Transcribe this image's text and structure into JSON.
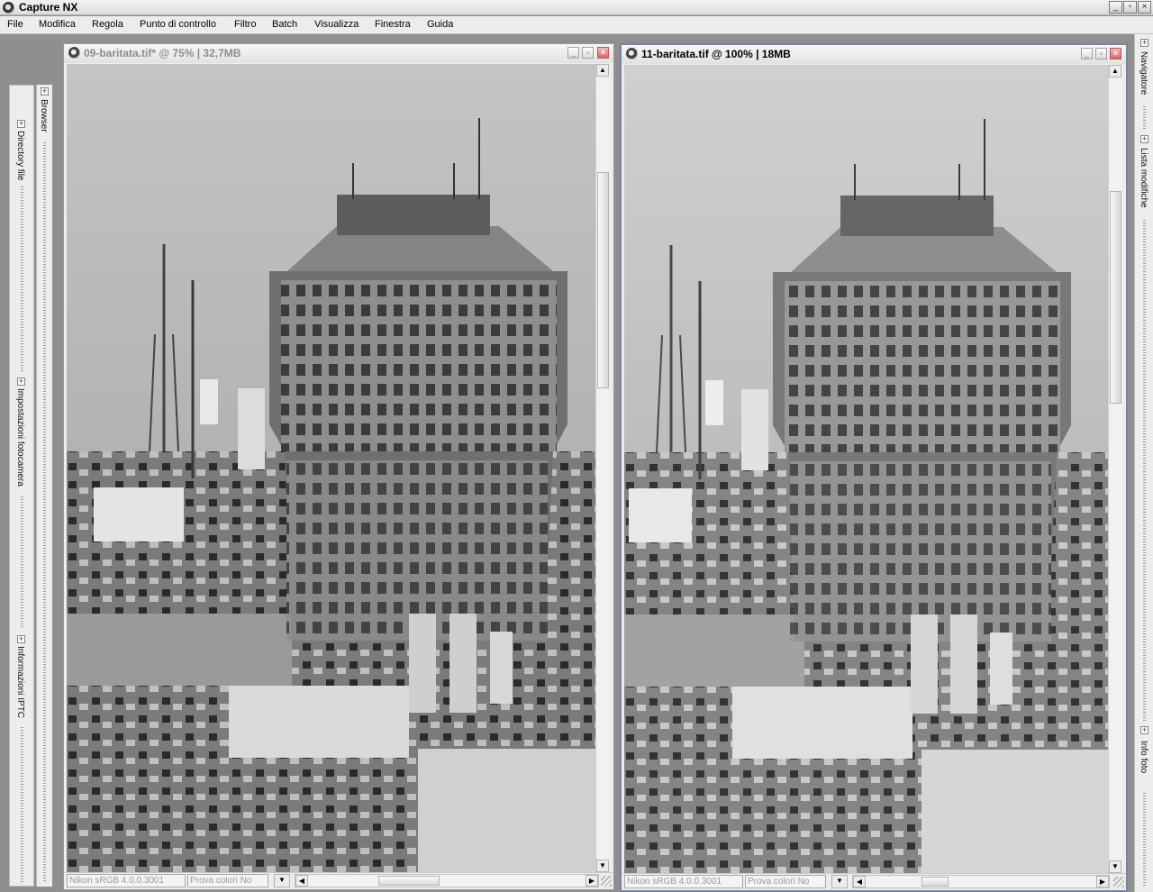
{
  "app": {
    "title": "Capture NX",
    "title_controls": [
      "_",
      "▫",
      "×"
    ]
  },
  "menu": [
    "File",
    "Modifica",
    "Regola",
    "Punto di controllo",
    "Filtro",
    "Batch",
    "Visualizza",
    "Finestra",
    "Guida"
  ],
  "left_panel": {
    "browser_tab": "Browser",
    "tabs": [
      "Directory file",
      "Impostazioni fotocamera",
      "Informazioni IPTC"
    ]
  },
  "right_panel": {
    "tabs": [
      "Navigatore",
      "Lista modifiche",
      "Info foto"
    ]
  },
  "windows": [
    {
      "title": "09-baritata.tif* @ 75% | 32,7MB",
      "active": false,
      "profile": "Nikon sRGB 4.0.0.3001",
      "softproof": "Prova colori No"
    },
    {
      "title": "11-baritata.tif @ 100% | 18MB",
      "active": true,
      "profile": "Nikon sRGB 4.0.0.3001",
      "softproof": "Prova colori No"
    }
  ],
  "glyphs": {
    "minimize": "_",
    "maximize": "▫",
    "close": "×",
    "up": "▲",
    "down": "▼",
    "left": "◀",
    "right": "▶",
    "plus": "+",
    "dropdown": "▼"
  },
  "colors": {
    "workspace": "#8f8f8f",
    "active_border": "#7a84a2",
    "close_button": "#d86868"
  },
  "icons": [
    "capture-nx-app-icon",
    "document-icon",
    "minimize-icon",
    "maximize-icon",
    "close-icon",
    "plus-icon",
    "scroll-arrow-icon",
    "resize-grip-icon"
  ]
}
